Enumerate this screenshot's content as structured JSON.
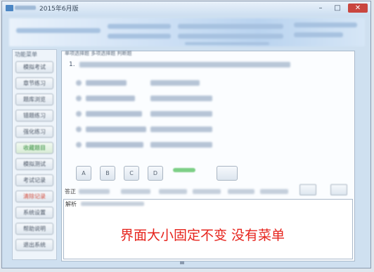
{
  "window": {
    "title": "2015年6月版",
    "minimize_symbol": "–",
    "maximize_symbol": "□",
    "close_symbol": "✕"
  },
  "left_panel": {
    "title": "功能菜单",
    "items": [
      {
        "label": "模拟考试"
      },
      {
        "label": "章节练习"
      },
      {
        "label": "题库浏览"
      },
      {
        "label": "错题练习"
      },
      {
        "label": "强化练习"
      },
      {
        "label": "收藏题目"
      },
      {
        "label": "模拟测试"
      },
      {
        "label": "考试记录"
      },
      {
        "label": "清除记录"
      },
      {
        "label": "系统设置"
      },
      {
        "label": "帮助说明"
      },
      {
        "label": "退出系统"
      }
    ]
  },
  "main": {
    "tabs_text": "单项选择题  多项选择题  判断题",
    "question_prefix": "1.",
    "buttons": [
      "A",
      "B",
      "C",
      "D"
    ],
    "answer_label": "答正",
    "explanation_label": "解析",
    "annotation": "界面大小固定不变  没有菜单"
  },
  "icons": {
    "app": "app-icon"
  }
}
